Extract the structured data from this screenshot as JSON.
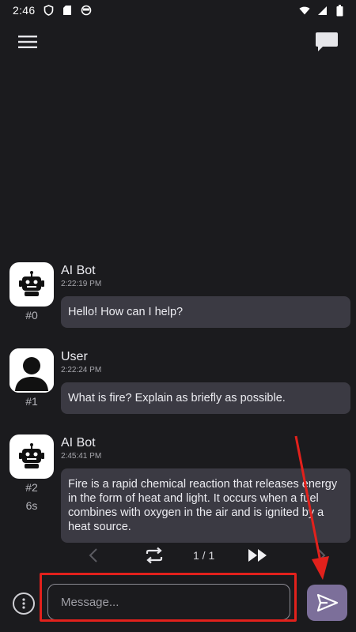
{
  "status_bar": {
    "time": "2:46",
    "icons": [
      "shield-icon",
      "sd-card-icon",
      "circle-icon",
      "wifi-icon",
      "signal-icon",
      "battery-icon"
    ]
  },
  "app_bar": {
    "left_icon": "menu-icon",
    "right_icon": "chat-bubble-icon"
  },
  "messages": [
    {
      "sender": "AI Bot",
      "time": "2:22:19 PM",
      "index": "#0",
      "text": "Hello! How can I help?",
      "avatar": "robot-icon"
    },
    {
      "sender": "User",
      "time": "2:22:24 PM",
      "index": "#1",
      "text": "What is fire? Explain as briefly as possible.",
      "avatar": "user-icon"
    },
    {
      "sender": "AI Bot",
      "time": "2:45:41 PM",
      "index": "#2",
      "duration": "6s",
      "text": "Fire is a rapid chemical reaction that releases energy in the form of heat and light. It occurs when a fuel combines with oxygen in the air and is ignited by a heat source.",
      "avatar": "robot-icon"
    }
  ],
  "response_nav": {
    "count": "1 / 1",
    "icons": [
      "chevron-left-icon",
      "regenerate-icon",
      "fast-forward-icon",
      "chevron-right-icon"
    ]
  },
  "input": {
    "placeholder": "Message...",
    "value": ""
  },
  "colors": {
    "background": "#1b1b1e",
    "bubble": "#3b3a43",
    "send_button": "#7c6f9a",
    "annotation": "#e2211c"
  }
}
